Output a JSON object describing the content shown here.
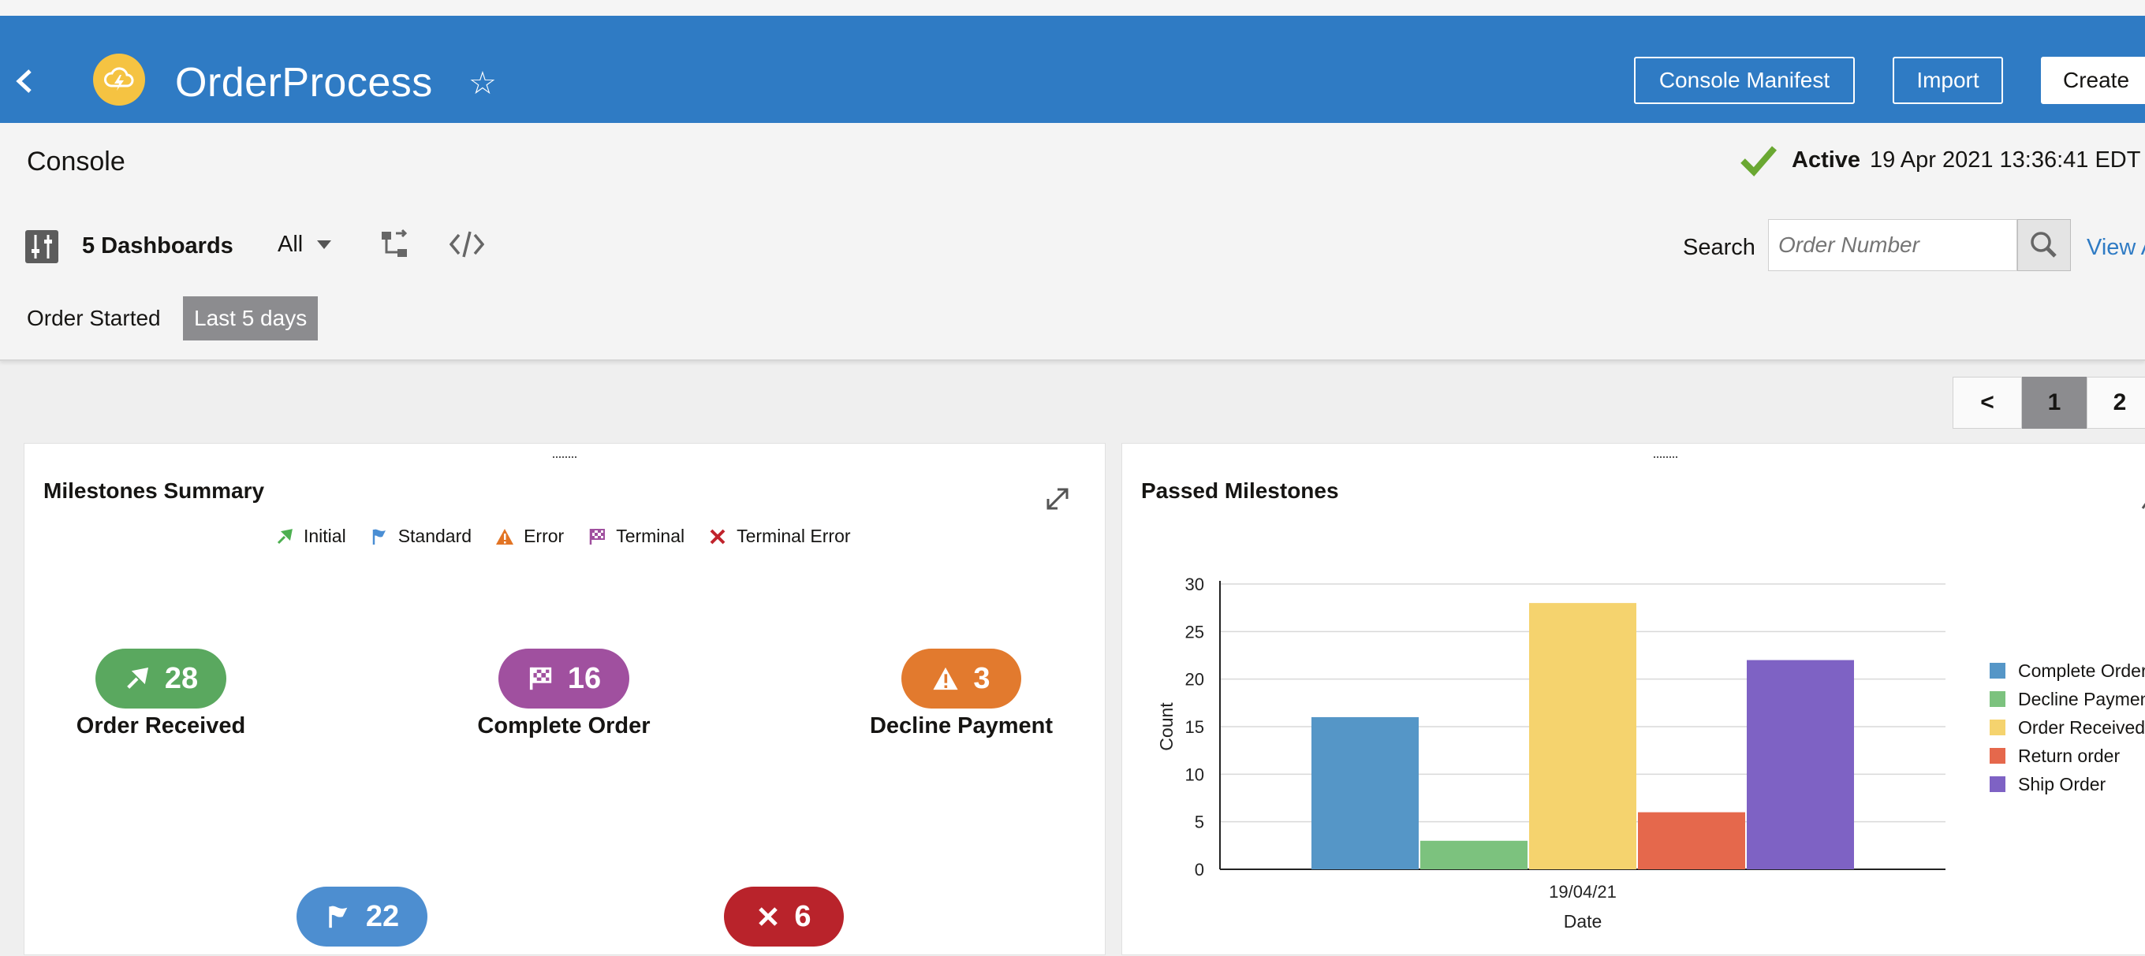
{
  "header": {
    "app_title": "OrderProcess",
    "buttons": {
      "console_manifest": "Console Manifest",
      "import": "Import",
      "create": "Create"
    },
    "colors": {
      "bar": "#2f7bc4",
      "logo": "#f5c342"
    }
  },
  "console": {
    "title": "Console",
    "status_label": "Active",
    "status_time": "19 Apr 2021 13:36:41 EDT",
    "dashboards_count": "5 Dashboards",
    "filter_value": "All",
    "search_label": "Search",
    "search_placeholder": "Order Number",
    "view_link": "View A",
    "order_started_label": "Order Started",
    "order_started_value": "Last 5 days"
  },
  "pagination": {
    "prev": "<",
    "pages": [
      "1",
      "2"
    ],
    "current": "1"
  },
  "milestones_panel": {
    "title": "Milestones Summary",
    "legend": [
      {
        "label": "Initial",
        "icon": "initial-icon",
        "color": "#4caf50"
      },
      {
        "label": "Standard",
        "icon": "standard-flag-icon",
        "color": "#4a8ed4"
      },
      {
        "label": "Error",
        "icon": "error-warning-icon",
        "color": "#e27424"
      },
      {
        "label": "Terminal",
        "icon": "terminal-checkered-flag-icon",
        "color": "#a0509f"
      },
      {
        "label": "Terminal Error",
        "icon": "terminal-error-x-icon",
        "color": "#c0232c"
      }
    ],
    "items": [
      {
        "name": "Order Received",
        "count": "28",
        "type": "Initial",
        "color": "#5aa85f"
      },
      {
        "name": "Complete Order",
        "count": "16",
        "type": "Terminal",
        "color": "#a0509f"
      },
      {
        "name": "Decline Payment",
        "count": "3",
        "type": "Error",
        "color": "#e27a2e"
      },
      {
        "name": "",
        "count": "22",
        "type": "Standard",
        "color": "#4d8ed0"
      },
      {
        "name": "",
        "count": "6",
        "type": "Terminal Error",
        "color": "#b9232b"
      }
    ]
  },
  "passed_panel": {
    "title": "Passed Milestones"
  },
  "chart_data": {
    "type": "bar",
    "categories": [
      "19/04/21"
    ],
    "series": [
      {
        "name": "Complete Order",
        "values": [
          16
        ],
        "color": "#5596c7"
      },
      {
        "name": "Decline Payment",
        "values": [
          3
        ],
        "color": "#7cc27e"
      },
      {
        "name": "Order Received",
        "values": [
          28
        ],
        "color": "#f5d36e"
      },
      {
        "name": "Return order",
        "values": [
          6
        ],
        "color": "#e5684c"
      },
      {
        "name": "Ship Order",
        "values": [
          22
        ],
        "color": "#7e62c4"
      }
    ],
    "xlabel": "Date",
    "ylabel": "Count",
    "ylim": [
      0,
      30
    ],
    "yticks": [
      0,
      5,
      10,
      15,
      20,
      25,
      30
    ],
    "grid": true,
    "legend_position": "right"
  }
}
